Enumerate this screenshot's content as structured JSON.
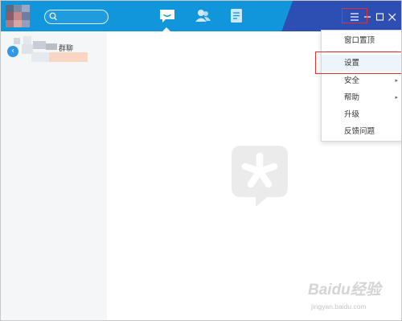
{
  "window": {
    "search_placeholder": "",
    "nav": [
      "message-icon",
      "contacts-icon",
      "workbench-icon"
    ],
    "controls": [
      "menu-icon",
      "minimize-icon",
      "maximize-icon",
      "close-icon"
    ],
    "colors": {
      "topbar": "#1296db",
      "topbar_dark": "#2d4eb3",
      "highlight": "#e2322f",
      "left_panel": "#f4f6f8"
    }
  },
  "sidebar": {
    "chat_item": {
      "name_suffix": "群聊"
    }
  },
  "menu": {
    "items": [
      {
        "label": "窗口置顶",
        "submenu": false
      },
      {
        "label": "设置",
        "submenu": false,
        "highlighted": true
      },
      {
        "label": "安全",
        "submenu": true
      },
      {
        "label": "帮助",
        "submenu": true
      },
      {
        "label": "升级",
        "submenu": false
      },
      {
        "label": "反馈问题",
        "submenu": false
      }
    ],
    "submenu_arrow": "▸"
  },
  "watermark": {
    "text": "Baidu经验",
    "url": "jingyan.baidu.com"
  }
}
